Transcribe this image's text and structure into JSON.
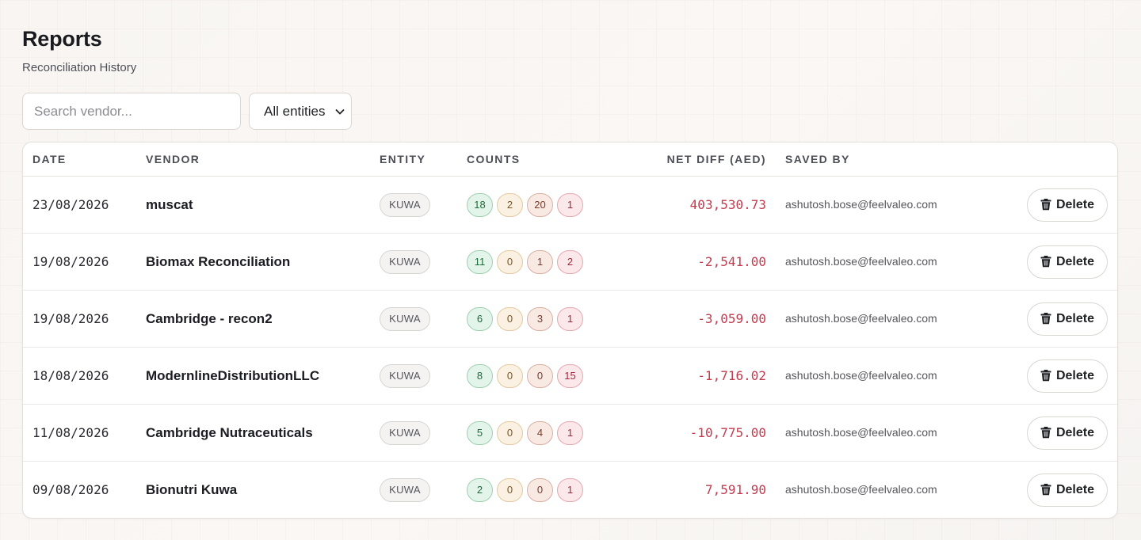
{
  "page": {
    "title": "Reports",
    "subtitle": "Reconciliation History"
  },
  "filters": {
    "search_placeholder": "Search vendor...",
    "entity_selected": "All entities"
  },
  "table": {
    "headers": {
      "date": "DATE",
      "vendor": "VENDOR",
      "entity": "ENTITY",
      "counts": "COUNTS",
      "net_diff": "NET DIFF (AED)",
      "saved_by": "SAVED BY"
    },
    "delete_label": "Delete",
    "rows": [
      {
        "date": "23/08/2026",
        "vendor": "muscat",
        "entity": "KUWA",
        "counts": [
          "18",
          "2",
          "20",
          "1"
        ],
        "net_diff": "403,530.73",
        "saved_by": "ashutosh.bose@feelvaleo.com"
      },
      {
        "date": "19/08/2026",
        "vendor": "Biomax Reconciliation",
        "entity": "KUWA",
        "counts": [
          "11",
          "0",
          "1",
          "2"
        ],
        "net_diff": "-2,541.00",
        "saved_by": "ashutosh.bose@feelvaleo.com"
      },
      {
        "date": "19/08/2026",
        "vendor": "Cambridge - recon2",
        "entity": "KUWA",
        "counts": [
          "6",
          "0",
          "3",
          "1"
        ],
        "net_diff": "-3,059.00",
        "saved_by": "ashutosh.bose@feelvaleo.com"
      },
      {
        "date": "18/08/2026",
        "vendor": "ModernlineDistributionLLC",
        "entity": "KUWA",
        "counts": [
          "8",
          "0",
          "0",
          "15"
        ],
        "net_diff": "-1,716.02",
        "saved_by": "ashutosh.bose@feelvaleo.com"
      },
      {
        "date": "11/08/2026",
        "vendor": "Cambridge Nutraceuticals",
        "entity": "KUWA",
        "counts": [
          "5",
          "0",
          "4",
          "1"
        ],
        "net_diff": "-10,775.00",
        "saved_by": "ashutosh.bose@feelvaleo.com"
      },
      {
        "date": "09/08/2026",
        "vendor": "Bionutri Kuwa",
        "entity": "KUWA",
        "counts": [
          "2",
          "0",
          "0",
          "1"
        ],
        "net_diff": "7,591.90",
        "saved_by": "ashutosh.bose@feelvaleo.com"
      }
    ]
  },
  "colors": {
    "count_matched": "#e3f4ea",
    "count_partial": "#fbf1e2",
    "count_mismatch": "#f8e9e3",
    "count_missing": "#fbe8ea",
    "net_diff_text": "#c23b4f"
  },
  "icons": {
    "delete": "trash-icon",
    "select": "chevron-down-icon"
  }
}
